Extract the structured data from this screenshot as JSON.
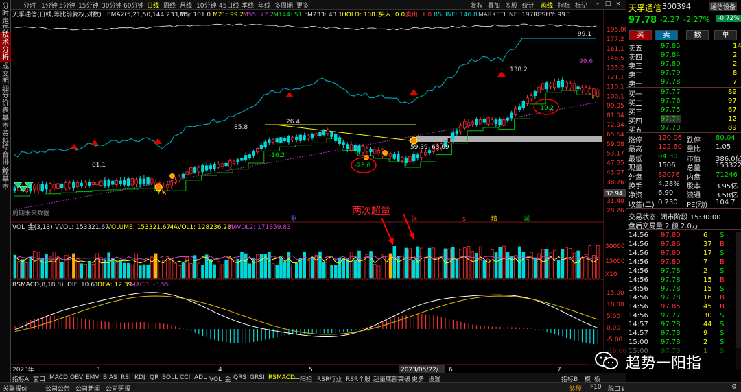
{
  "left_tabs": [
    "分时走势",
    "技术分析",
    "成交明细",
    "分价表",
    "基本资料",
    "综合排名",
    "控基本"
  ],
  "topbar": {
    "periods": [
      "分时",
      "1分钟",
      "5分钟",
      "15分钟",
      "30分钟",
      "60分钟",
      "日线",
      "周线",
      "月线",
      "10分钟",
      "45日线",
      "季线",
      "年线",
      "多周期",
      "更多"
    ],
    "active_period": "日线",
    "tools": [
      "复权",
      "叠加",
      "多股",
      "统计",
      "画线",
      "指标",
      "标记"
    ]
  },
  "chart": {
    "legend": {
      "title": "天孚通信(日线,等比前复权,对数)",
      "ema2": "EMA2(5,21,50,144,233,15)",
      "m5": "M5: 101.0",
      "m21": "M21: 99.2",
      "m55": "M55: 77.2",
      "m144": "M144: 51.5",
      "m233": "M233: 43.1",
      "hold": "HOLD: 108.7",
      "buy": "买入: 0.0",
      "sell": "卖出: 1.0",
      "rsline": "RSLINE: 146.8",
      "marketline": "MARKETLINE: 197.0",
      "rpshy": "RPSHY: 99.1"
    },
    "price_axis": [
      "195.00",
      "177.2",
      "161.1",
      "146.5",
      "133.2",
      "121.1",
      "110.1",
      "100.1",
      "90.05",
      "81.04",
      "72.94",
      "65.64",
      "59.08",
      "53.17",
      "47.85",
      "43.07",
      "38.76",
      "34.89",
      "31.40",
      "28.26"
    ],
    "last_price_tag": "32.94",
    "annotations": [
      "81.1",
      "85.8",
      "26.4",
      "-16.2",
      "-28.6",
      "59.39",
      "63.09",
      "138.2",
      "-19.2",
      "99.1",
      "99.6",
      "7.5"
    ],
    "labels": {
      "future": "周期未来数据",
      "cai": "财",
      "zhang": "张",
      "s": "s",
      "jing": "精",
      "jian": "减",
      "twice": "两次超量"
    },
    "vol_legend": {
      "name": "VOL_金(3,13)",
      "vvol": "VVOL: 153321.67",
      "volume": "VOLUME: 153321.67",
      "mavol1": "MAVOL1: 128236.23",
      "mavol2": "MAVOL2: 171859.83"
    },
    "vol_axis": [
      "30000",
      "15000",
      "X10"
    ],
    "macd_legend": {
      "name": "RSMACD(8,18,8)",
      "dif": "DIF: 10.61",
      "dea": "DEA: 12.39",
      "macd": "MACD: -3.55"
    },
    "macd_axis": [
      "15.00",
      "10.00",
      "5.00",
      "0.00",
      "-5.00",
      "-10.00"
    ],
    "x_labels": [
      "2023年",
      "3",
      "4",
      "5",
      "2023/05/22/一",
      "6",
      "7"
    ]
  },
  "bottom_tabs": [
    "指标A",
    "窗口",
    "MACD",
    "OBV",
    "EMV",
    "BIAS",
    "RSI",
    "KDJ",
    "QR",
    "BOLL",
    "CCI",
    "ADL",
    "VOL_金",
    "QRS",
    "GRSI",
    "RSMACD",
    "一阳指",
    "RSR行业",
    "RSR个股",
    "超量底部突破",
    "更多",
    "设置"
  ],
  "active_bottom_tab": "RSMACD",
  "bottom_right": [
    "指标B",
    "模",
    "板"
  ],
  "status": [
    "关联报价",
    "公司公告",
    "公司新闻",
    "公司研报"
  ],
  "status_right": [
    "诊股",
    "F10",
    "脱口↓",
    "⚙"
  ],
  "quote": {
    "name": "天孚通信",
    "code": "300394",
    "badge": "通信设备",
    "change_pct_badge": "-0.72%",
    "price": "97.78",
    "change": "-2.27",
    "change_pct": "-2.27%",
    "buttons": [
      "买",
      "卖",
      "撤",
      "单"
    ],
    "asks": [
      [
        "卖五",
        "97.85",
        "14"
      ],
      [
        "卖四",
        "97.84",
        "2"
      ],
      [
        "卖三",
        "97.80",
        "2"
      ],
      [
        "卖二",
        "97.79",
        "8"
      ],
      [
        "卖一",
        "97.78",
        "7"
      ]
    ],
    "bids": [
      [
        "买一",
        "97.77",
        "89"
      ],
      [
        "买二",
        "97.76",
        "97"
      ],
      [
        "买三",
        "97.75",
        "67"
      ],
      [
        "买四",
        "97.74",
        "12"
      ],
      [
        "买五",
        "97.73",
        "89"
      ]
    ],
    "stats": [
      [
        "涨停",
        "120.06",
        "跌停",
        "80.04"
      ],
      [
        "最高",
        "102.60",
        "量比",
        "1.05"
      ],
      [
        "最低",
        "94.30",
        "市值",
        "386.0亿"
      ],
      [
        "现量",
        "1506",
        "总量",
        "153322"
      ],
      [
        "外盘",
        "82076",
        "内盘",
        "71246"
      ],
      [
        "换手",
        "4.28%",
        "股本",
        "3.95亿"
      ],
      [
        "净资",
        "6.90",
        "流通",
        "3.58亿"
      ],
      [
        "收益(二)",
        "0.230",
        "PE(动)",
        "104.7"
      ]
    ],
    "trade_state": "交易状态: 闭市阶段 15:30:00",
    "after_hours": "盘后交易量 2 额 2.0万",
    "ticks": [
      [
        "14:56",
        "97.80",
        "6",
        "S"
      ],
      [
        "14:56",
        "97.86",
        "37",
        "B"
      ],
      [
        "14:56",
        "97.80",
        "17",
        "S"
      ],
      [
        "14:56",
        "97.80",
        "7",
        "B"
      ],
      [
        "14:56",
        "97.78",
        "2",
        "S"
      ],
      [
        "14:56",
        "97.78",
        "15",
        "B"
      ],
      [
        "14:56",
        "97.78",
        "15",
        "S"
      ],
      [
        "14:56",
        "97.78",
        "16",
        "B"
      ],
      [
        "14:56",
        "97.85",
        "45",
        "B"
      ],
      [
        "14:56",
        "97.77",
        "30",
        "S"
      ],
      [
        "14:57",
        "97.78",
        "44",
        "S"
      ],
      [
        "14:57",
        "97.78",
        "9",
        "S"
      ],
      [
        "15:00",
        "97.78",
        "2",
        "S"
      ],
      [
        "15:00",
        "97.78",
        "1",
        "S"
      ]
    ]
  },
  "watermark": "趋势一阳指",
  "colors": {
    "up": "#ff3333",
    "down": "#00e0e0",
    "ma": "#ffff00",
    "rs": "#00a0b0",
    "purple": "#c040c0"
  }
}
